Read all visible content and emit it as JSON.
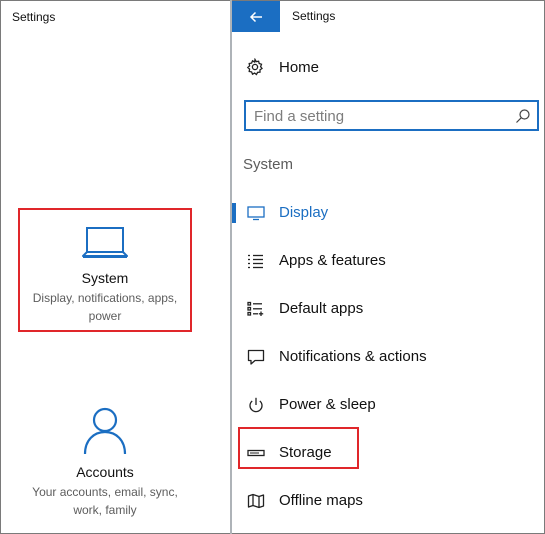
{
  "left_window": {
    "title": "Settings",
    "categories": [
      {
        "title": "System",
        "description": "Display, notifications, apps, power",
        "icon": "laptop-icon"
      },
      {
        "title": "Accounts",
        "description": "Your accounts, email, sync, work, family",
        "icon": "person-icon"
      }
    ]
  },
  "right_window": {
    "title": "Settings",
    "back_icon": "back-arrow-icon",
    "home": {
      "label": "Home",
      "icon": "gear-icon"
    },
    "search": {
      "placeholder": "Find a setting",
      "value": "",
      "icon": "search-icon"
    },
    "section_label": "System",
    "nav_items": [
      {
        "label": "Display",
        "icon": "display-icon",
        "active": true
      },
      {
        "label": "Apps & features",
        "icon": "apps-list-icon",
        "active": false
      },
      {
        "label": "Default apps",
        "icon": "default-apps-icon",
        "active": false
      },
      {
        "label": "Notifications & actions",
        "icon": "notifications-icon",
        "active": false
      },
      {
        "label": "Power & sleep",
        "icon": "power-icon",
        "active": false
      },
      {
        "label": "Storage",
        "icon": "storage-icon",
        "active": false
      },
      {
        "label": "Offline maps",
        "icon": "map-icon",
        "active": false
      }
    ]
  },
  "colors": {
    "accent": "#1b6ec2",
    "highlight_border": "#e0262a",
    "text": "#111111",
    "muted_text": "#5d5d5d"
  }
}
